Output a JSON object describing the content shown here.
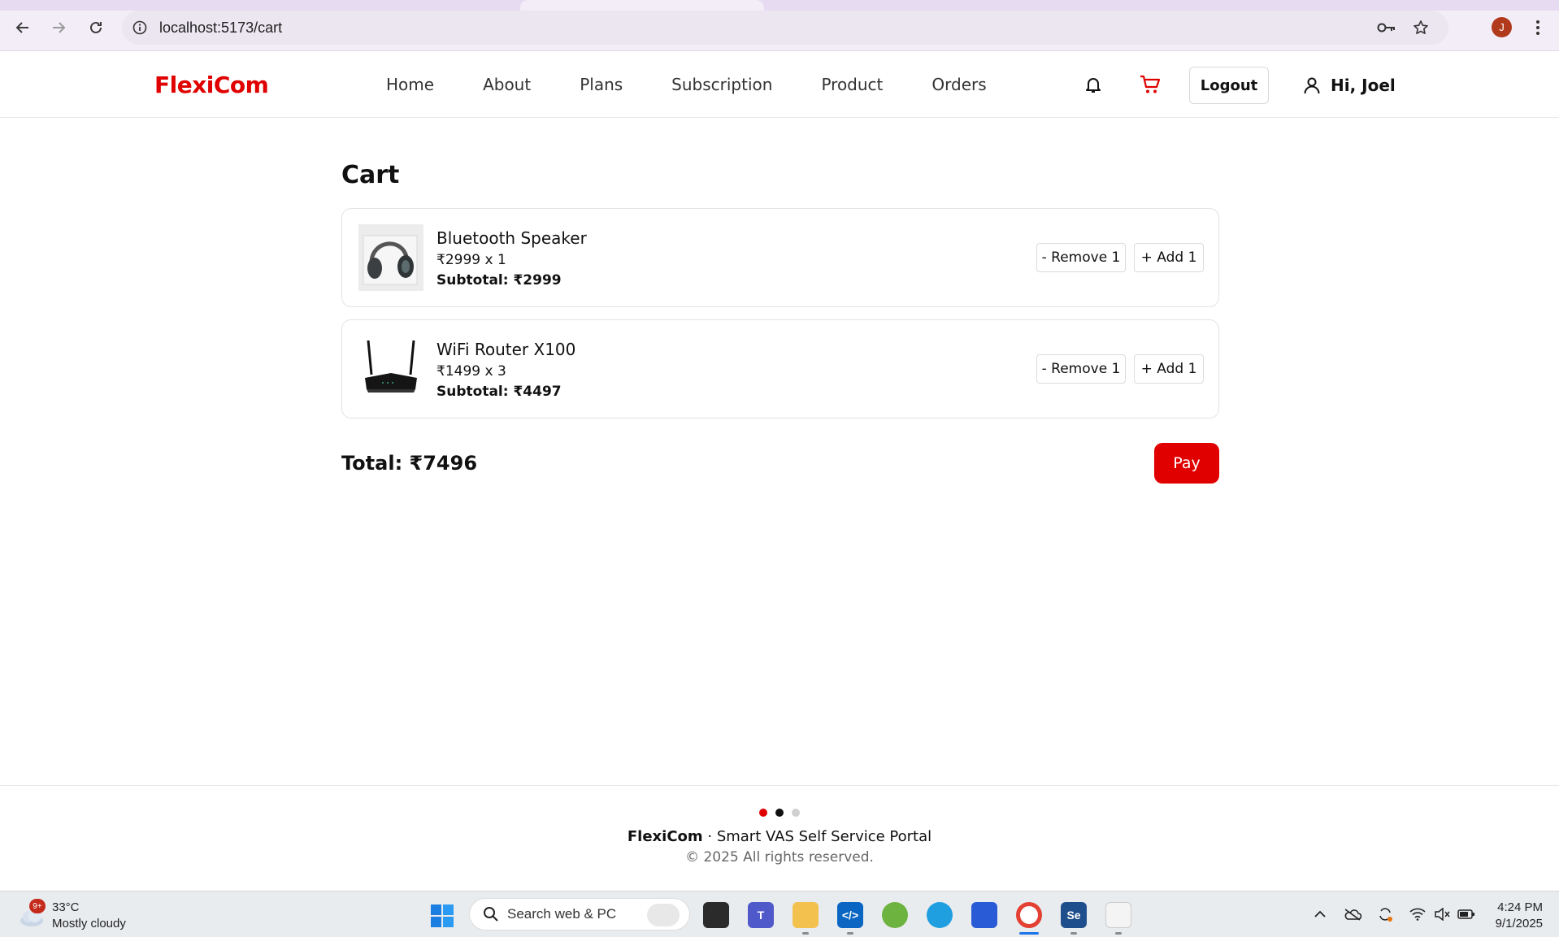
{
  "browser": {
    "url": "localhost:5173/cart",
    "profile_initial": "J"
  },
  "header": {
    "brand": "FlexiCom",
    "nav": [
      "Home",
      "About",
      "Plans",
      "Subscription",
      "Product",
      "Orders"
    ],
    "logout_label": "Logout",
    "greeting": "Hi, Joel",
    "accent_color": "#e00000"
  },
  "cart": {
    "title": "Cart",
    "items": [
      {
        "name": "Bluetooth Speaker",
        "qty_line": "₹2999 x 1",
        "subtotal": "Subtotal: ₹2999",
        "remove_label": "- Remove 1",
        "add_label": "+ Add 1",
        "image_icon": "headphones-image"
      },
      {
        "name": "WiFi Router X100",
        "qty_line": "₹1499 x 3",
        "subtotal": "Subtotal: ₹4497",
        "remove_label": "- Remove 1",
        "add_label": "+ Add 1",
        "image_icon": "router-image"
      }
    ],
    "total": "Total: ₹7496",
    "pay_label": "Pay"
  },
  "footer": {
    "brand": "FlexiCom",
    "tagline": " · Smart VAS Self Service Portal",
    "copyright": "© 2025 All rights reserved.",
    "dot_colors": [
      "#e00000",
      "#111111",
      "#d0d0d0"
    ]
  },
  "taskbar": {
    "weather_badge": "9+",
    "temperature": "33°C",
    "condition": "Mostly cloudy",
    "search_placeholder": "Search web & PC",
    "time": "4:24 PM",
    "date": "9/1/2025"
  }
}
